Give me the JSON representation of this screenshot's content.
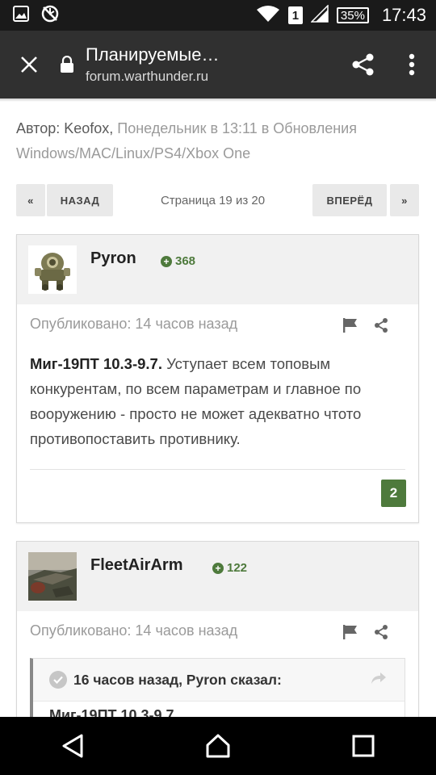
{
  "status_bar": {
    "time": "17:43",
    "battery": "35%",
    "sim": "1"
  },
  "browser": {
    "title": "Планируемые…",
    "url": "forum.warthunder.ru"
  },
  "topic": {
    "author_prefix": "Автор: Keofox,",
    "author_rest": " Понедельник в 13:11 в Обновления Windows/MAC/Linux/PS4/Xbox One"
  },
  "pagination": {
    "first_symbol": "«",
    "prev_label": "НАЗАД",
    "info": "Страница 19 из 20",
    "next_label": "ВПЕРЁД",
    "last_symbol": "»"
  },
  "posts": [
    {
      "username": "Pyron",
      "reputation": "368",
      "posted": "Опубликовано: 14 часов назад",
      "body_bold": "Миг-19ПТ 10.3-9.7.",
      "body_text": "  Уступает всем топовым конкурентам, по всем параметрам и главное по вооружению - просто не может адекватно чтото противопоставить противнику.",
      "likes": "2"
    },
    {
      "username": "FleetAirArm",
      "reputation": "122",
      "posted": "Опубликовано: 14 часов назад",
      "quote_header": "16 часов назад, Pyron сказал:",
      "quote_preview": "Миг-19ПТ 10.3-9.7."
    }
  ],
  "colors": {
    "status_bar_bg": "#1a1a1a",
    "browser_bar_bg": "#303030",
    "reputation_green": "#4e7a3c",
    "post_header_bg": "#f1f1f1"
  },
  "icons": {
    "status_left": [
      "image-icon",
      "no-sync-icon"
    ],
    "status_right": [
      "wifi-icon",
      "sim-icon",
      "signal-icon",
      "battery-icon"
    ],
    "browser": [
      "close-icon",
      "lock-icon",
      "share-icon",
      "more-vert-icon"
    ],
    "post": [
      "flag-icon",
      "share-icon",
      "plus-icon",
      "check-icon",
      "reply-arrow-icon"
    ],
    "nav": [
      "back-icon",
      "home-icon",
      "recents-icon"
    ]
  }
}
